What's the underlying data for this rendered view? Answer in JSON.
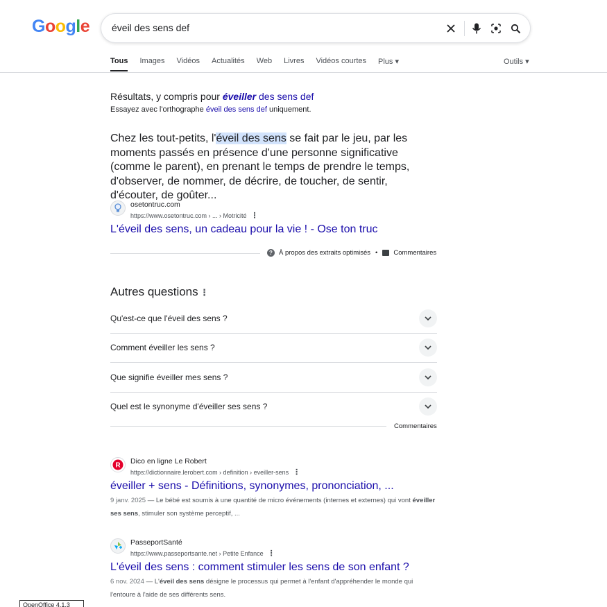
{
  "header": {
    "logo_letters": [
      "G",
      "o",
      "o",
      "g",
      "l",
      "e"
    ],
    "logo_colors": [
      "#4285f4",
      "#ea4335",
      "#fbbc05",
      "#4285f4",
      "#34a853",
      "#ea4335"
    ],
    "search_value": "éveil des sens def",
    "tabs": [
      "Tous",
      "Images",
      "Vidéos",
      "Actualités",
      "Web",
      "Livres",
      "Vidéos courtes",
      "Plus ▾"
    ],
    "tools_label": "Outils ▾"
  },
  "spelling": {
    "prefix": "Résultats, y compris pour ",
    "corrected_word": "éveiller",
    "corrected_rest": " des sens def",
    "try_prefix": "Essayez avec l'orthographe ",
    "try_query": "éveil des sens def",
    "try_suffix": " uniquement."
  },
  "snippet": {
    "text_before": "Chez les tout-petits, l'",
    "highlight": "éveil des sens",
    "text_after": " se fait par le jeu, par les moments passés en présence d'une personne significative (comme le parent), en prenant le temps de prendre le temps, d'observer, de nommer, de décrire, de toucher, de sentir, d'écouter, de goûter...",
    "site_name": "osetontruc.com",
    "site_url": "https://www.osetontruc.com › ... › Motricité",
    "title": "L'éveil des sens, un cadeau pour la vie ! - Ose ton truc",
    "about_label": "À propos des extraits optimisés",
    "dot": "•",
    "feedback_label": "Commentaires"
  },
  "paa": {
    "title": "Autres questions",
    "questions": [
      "Qu'est-ce que l'éveil des sens ?",
      "Comment éveiller les sens ?",
      "Que signifie éveiller mes sens ?",
      "Quel est le synonyme d'éveiller ses sens ?"
    ],
    "feedback_label": "Commentaires"
  },
  "results": [
    {
      "site_name": "Dico en ligne Le Robert",
      "site_url": "https://dictionnaire.lerobert.com › definition › eveiller-sens",
      "title": "éveiller + sens - Définitions, synonymes, prononciation, ...",
      "date": "9 janv. 2025",
      "desc_before": " — Le bébé est soumis à une quantité de micro événements (internes et externes) qui vont ",
      "desc_bold": "éveiller ses sens",
      "desc_after": ", stimuler son système perceptif, ..."
    },
    {
      "site_name": "PasseportSanté",
      "site_url": "https://www.passeportsante.net › Petite Enfance",
      "title": "L'éveil des sens : comment stimuler les sens de son enfant ?",
      "date": "6 nov. 2024",
      "desc_before": " — L'",
      "desc_bold": "éveil des sens",
      "desc_after": " désigne le processus qui permet à l'enfant d'appréhender le monde qui l'entoure à l'aide de ses différents sens."
    }
  ],
  "taskbar_label": "OpenOffice 4.1.3",
  "icons": {
    "clear": "close-icon",
    "voice": "microphone-icon",
    "lens": "lens-icon",
    "search": "search-icon"
  }
}
